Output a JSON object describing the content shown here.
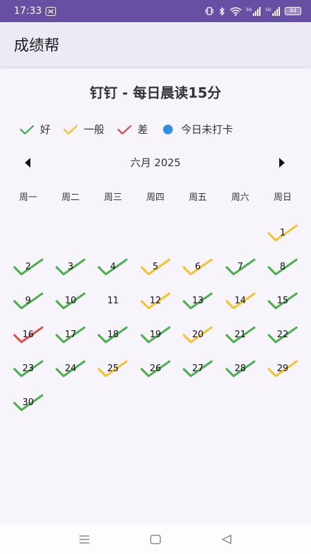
{
  "status_bar": {
    "time": "17:33",
    "battery": "44"
  },
  "app_bar": {
    "title": "成绩帮"
  },
  "page_title": "钉钉 - 每日晨读15分",
  "legend": {
    "items": [
      {
        "label": "好",
        "status": "good",
        "color": "#4caf50"
      },
      {
        "label": "一般",
        "status": "fair",
        "color": "#f4c430"
      },
      {
        "label": "差",
        "status": "bad",
        "color": "#d9534f"
      },
      {
        "label": "今日未打卡",
        "status": "today",
        "color": "#2f8fe0"
      }
    ]
  },
  "month_nav": {
    "label": "六月 2025",
    "prev_icon": "triangle-left-icon",
    "next_icon": "triangle-right-icon"
  },
  "weekdays": [
    "周一",
    "周二",
    "周三",
    "周四",
    "周五",
    "周六",
    "周日"
  ],
  "calendar": {
    "first_weekday_index": 6,
    "days": [
      {
        "day": "1",
        "status": "fair"
      },
      {
        "day": "2",
        "status": "good"
      },
      {
        "day": "3",
        "status": "good"
      },
      {
        "day": "4",
        "status": "good"
      },
      {
        "day": "5",
        "status": "fair"
      },
      {
        "day": "6",
        "status": "fair"
      },
      {
        "day": "7",
        "status": "good"
      },
      {
        "day": "8",
        "status": "good"
      },
      {
        "day": "9",
        "status": "good"
      },
      {
        "day": "10",
        "status": "good"
      },
      {
        "day": "11",
        "status": "none"
      },
      {
        "day": "12",
        "status": "fair"
      },
      {
        "day": "13",
        "status": "good"
      },
      {
        "day": "14",
        "status": "fair"
      },
      {
        "day": "15",
        "status": "good"
      },
      {
        "day": "16",
        "status": "bad"
      },
      {
        "day": "17",
        "status": "good"
      },
      {
        "day": "18",
        "status": "good"
      },
      {
        "day": "19",
        "status": "good"
      },
      {
        "day": "20",
        "status": "fair"
      },
      {
        "day": "21",
        "status": "good"
      },
      {
        "day": "22",
        "status": "good"
      },
      {
        "day": "23",
        "status": "good"
      },
      {
        "day": "24",
        "status": "good"
      },
      {
        "day": "25",
        "status": "fair"
      },
      {
        "day": "26",
        "status": "good"
      },
      {
        "day": "27",
        "status": "good"
      },
      {
        "day": "28",
        "status": "good"
      },
      {
        "day": "29",
        "status": "fair"
      },
      {
        "day": "30",
        "status": "good"
      }
    ]
  },
  "nav_bar": {
    "icons": [
      "menu-icon",
      "home-icon",
      "back-icon"
    ]
  }
}
